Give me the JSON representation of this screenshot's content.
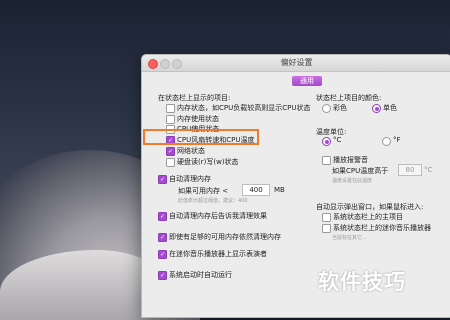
{
  "window": {
    "title": "偏好设置",
    "tab_general": "通用"
  },
  "left": {
    "section_title": "在状态栏上显示的项目:",
    "items": [
      {
        "label": "内存状态，如CPU负载较高则显示CPU状态",
        "checked": false
      },
      {
        "label": "内存使用状态",
        "checked": false
      },
      {
        "label": "CPU使用状态",
        "checked": false
      },
      {
        "label": "CPU风扇转速和CPU温度",
        "checked": true
      },
      {
        "label": "网络状态",
        "checked": true
      },
      {
        "label": "硬盘读(r)写(w)状态",
        "checked": false
      }
    ],
    "auto_clean": {
      "label": "自动清理内存",
      "checked": true
    },
    "available_label": "如果可用内存 <",
    "available_value": "400",
    "available_unit": "MB",
    "hint": "此值表示超过阈值，建议：400",
    "notify": {
      "label": "自动清理内存后告诉我清理效果",
      "checked": true
    },
    "always_clean": {
      "label": "即使有足够的可用内存依然清理内存",
      "checked": true
    },
    "music_player": {
      "label": "在迷你音乐播放器上显示表演者",
      "checked": true
    },
    "auto_start": {
      "label": "系统启动时自动运行",
      "checked": true
    }
  },
  "right": {
    "color_title": "状态栏上项目的颜色:",
    "color_options": [
      {
        "label": "彩色",
        "selected": false
      },
      {
        "label": "单色",
        "selected": true
      }
    ],
    "temp_title": "温度单位:",
    "temp_options": [
      {
        "label": "°C",
        "selected": true
      },
      {
        "label": "°F",
        "selected": false
      }
    ],
    "alarm": {
      "label": "播放报警音",
      "checked": false
    },
    "alarm_cond_label": "如果CPU温度高于",
    "alarm_value": "80",
    "alarm_unit": "°C",
    "alarm_hint": "温度设置在此温度",
    "popup_title": "自动显示弹出窗口，如果鼠标进入:",
    "popup_options": [
      {
        "label": "系统状态栏上的主项目",
        "checked": false
      },
      {
        "label": "系统状态栏上的迷你音乐播放器",
        "checked": false
      }
    ],
    "popup_hint": "当鼠标在其它..."
  },
  "watermark": "软件技巧"
}
